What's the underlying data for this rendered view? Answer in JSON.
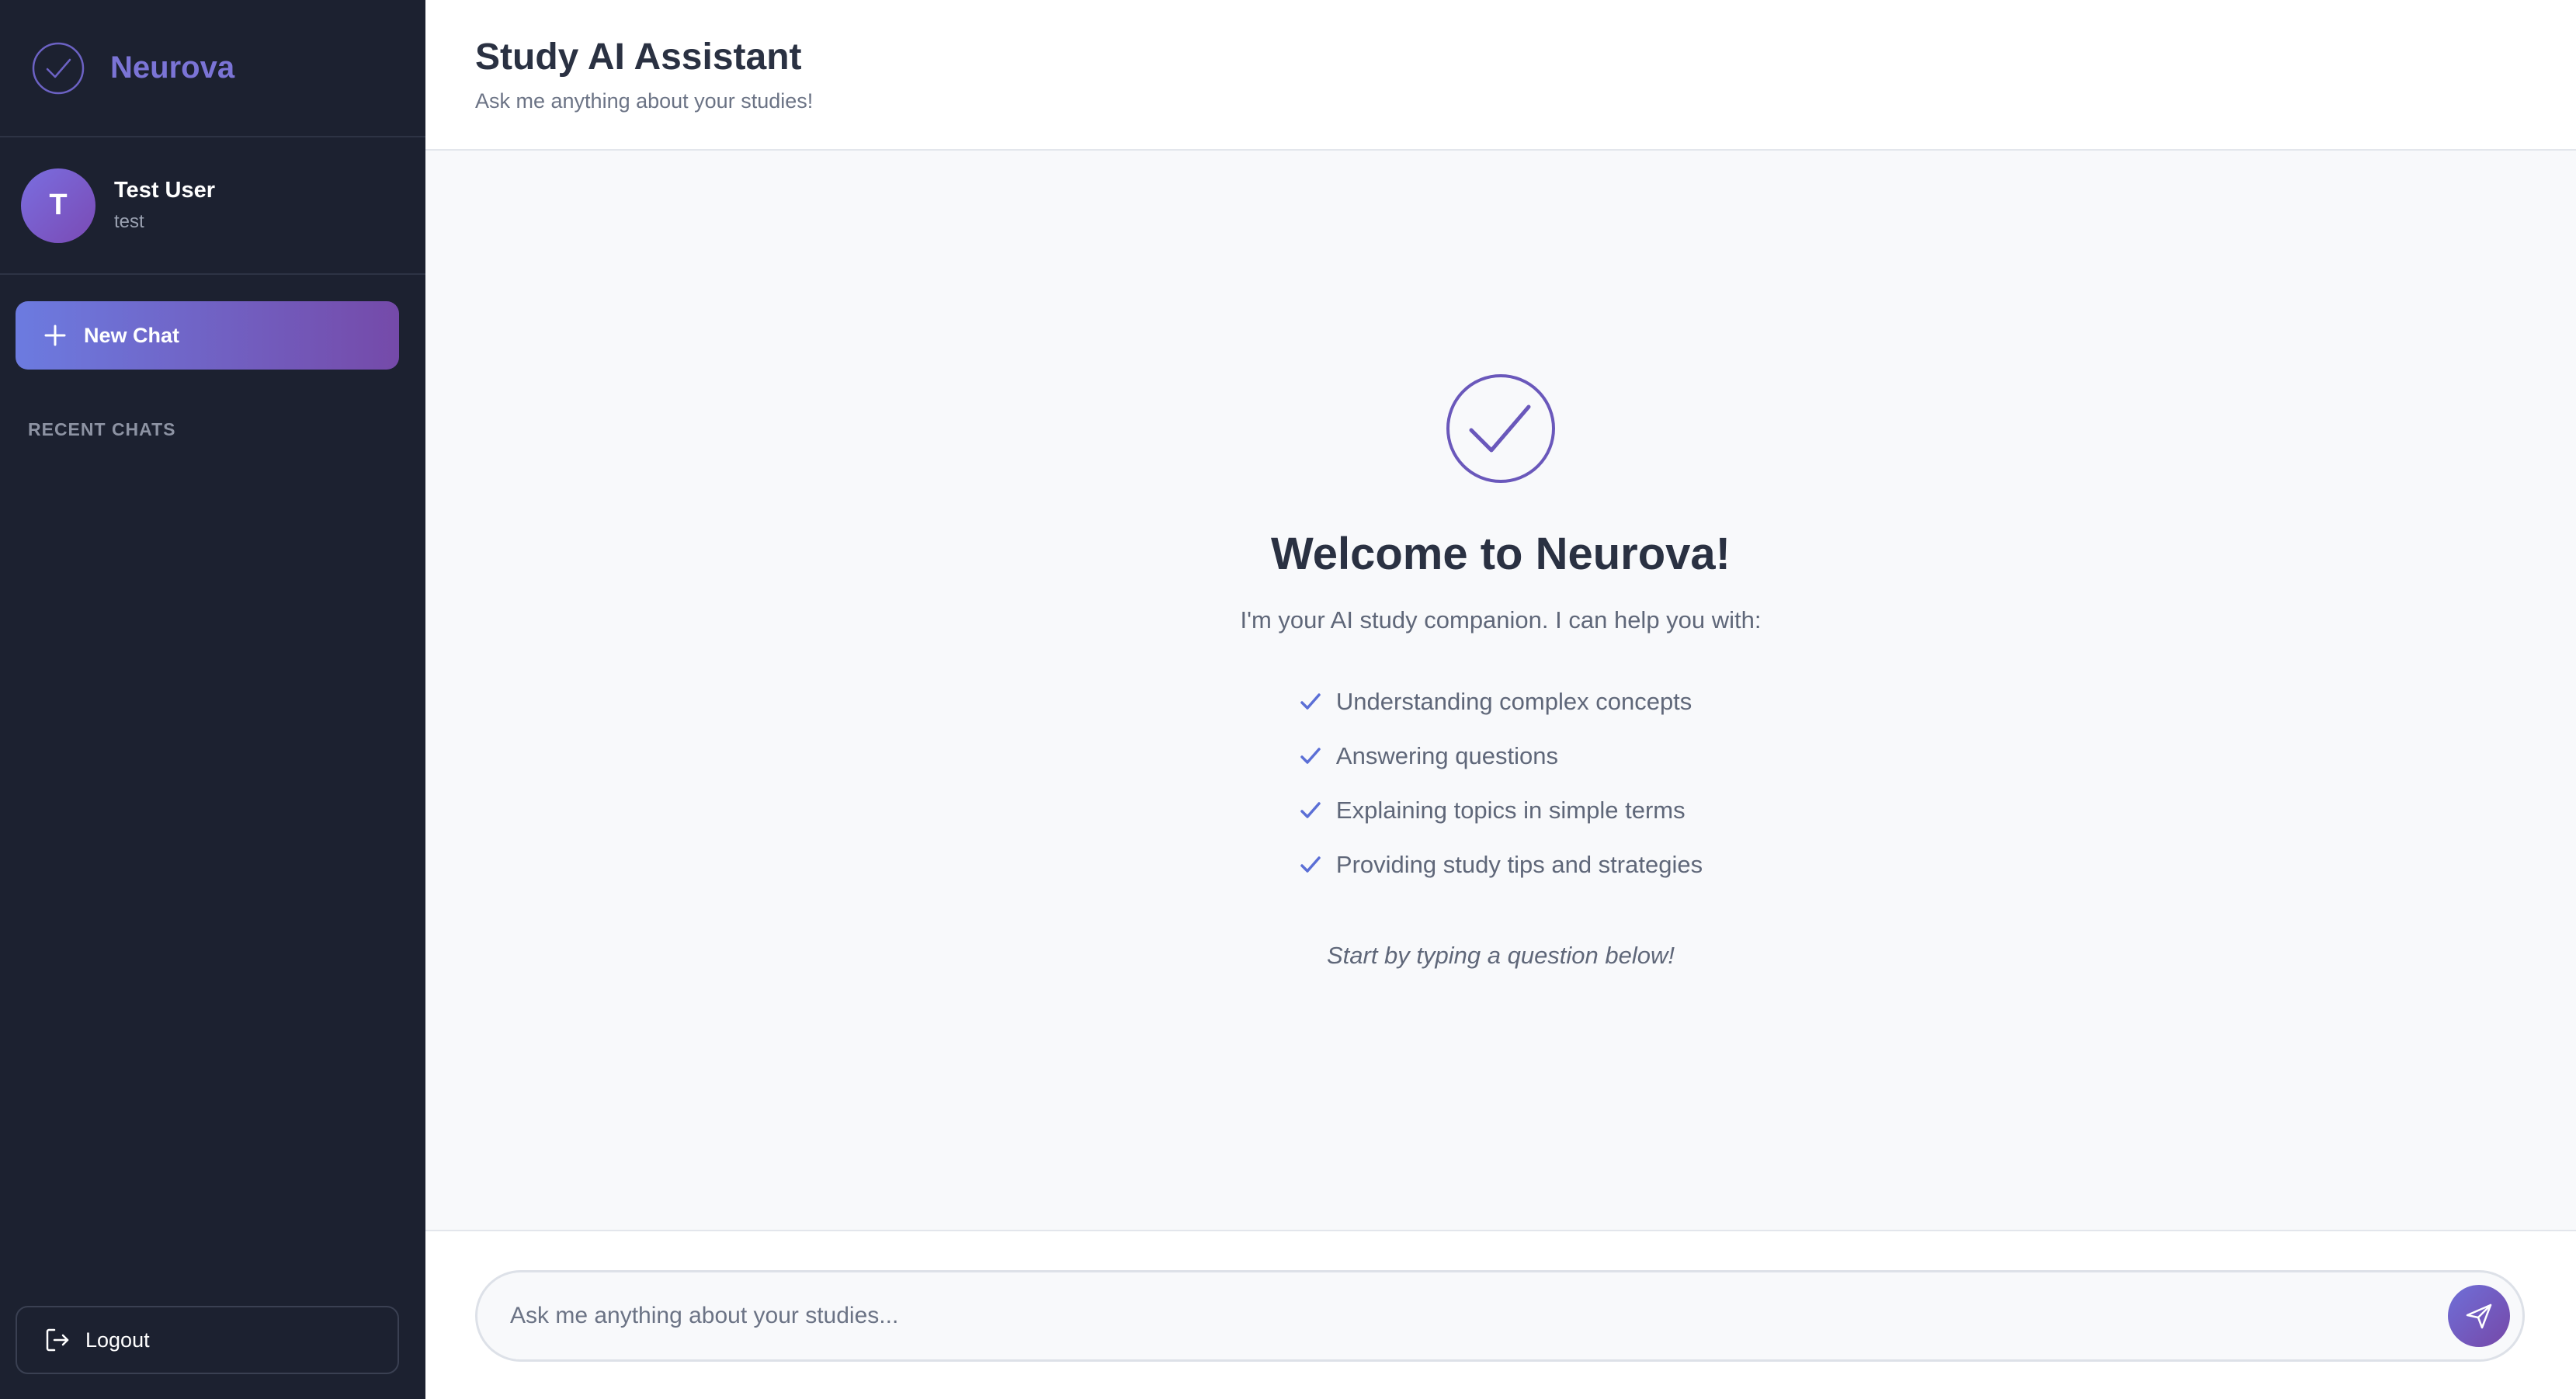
{
  "brand": {
    "name": "Neurova",
    "logo_icon": "check-circle-icon",
    "color": "#7b74d6"
  },
  "user": {
    "avatar_initial": "T",
    "name": "Test User",
    "handle": "test"
  },
  "sidebar": {
    "new_chat_label": "New Chat",
    "recent_chats_label": "RECENT CHATS",
    "recent_chats": [],
    "logout_label": "Logout"
  },
  "header": {
    "title": "Study AI Assistant",
    "subtitle": "Ask me anything about your studies!"
  },
  "welcome": {
    "title": "Welcome to Neurova!",
    "subtitle": "I'm your AI study companion. I can help you with:",
    "features": [
      "Understanding complex concepts",
      "Answering questions",
      "Explaining topics in simple terms",
      "Providing study tips and strategies"
    ],
    "hint": "Start by typing a question below!"
  },
  "composer": {
    "placeholder": "Ask me anything about your studies...",
    "value": "",
    "send_icon": "send-icon"
  },
  "colors": {
    "sidebar_bg": "#1c2130",
    "accent_start": "#6c7be0",
    "accent_end": "#754aa9",
    "check": "#5b6fd6"
  }
}
